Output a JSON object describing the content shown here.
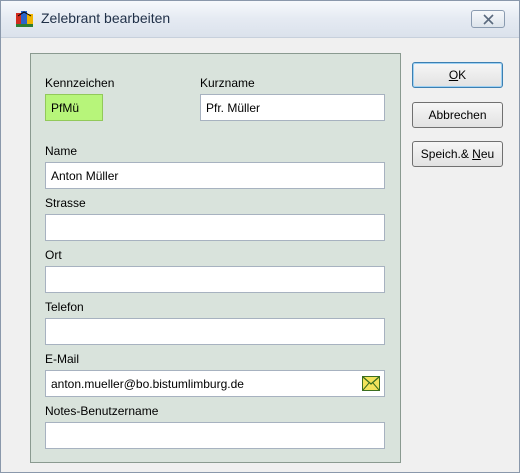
{
  "window": {
    "title": "Zelebrant bearbeiten"
  },
  "form": {
    "kennzeichen": {
      "label": "Kennzeichen",
      "value": "PfMü"
    },
    "kurzname": {
      "label": "Kurzname",
      "value": "Pfr. Müller"
    },
    "name": {
      "label": "Name",
      "value": "Anton Müller"
    },
    "strasse": {
      "label": "Strasse",
      "value": ""
    },
    "ort": {
      "label": "Ort",
      "value": ""
    },
    "telefon": {
      "label": "Telefon",
      "value": ""
    },
    "email": {
      "label": "E-Mail",
      "value": "anton.mueller@bo.bistumlimburg.de"
    },
    "notes": {
      "label": "Notes-Benutzername",
      "value": ""
    }
  },
  "buttons": {
    "ok": {
      "pre": "",
      "accel": "O",
      "post": "K"
    },
    "cancel": {
      "label": "Abbrechen"
    },
    "save_new": {
      "pre": "Speich.& ",
      "accel": "N",
      "post": "eu"
    }
  },
  "icons": {
    "app": "app-icon",
    "close": "close-icon",
    "mail": "mail-icon"
  },
  "colors": {
    "panel_bg": "#d9e3dc",
    "highlight_field": "#b7f57a"
  }
}
